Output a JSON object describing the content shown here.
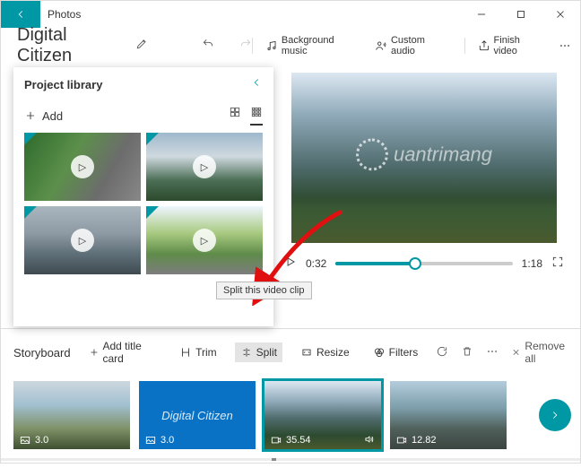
{
  "window": {
    "title": "Photos"
  },
  "project": {
    "name": "Digital Citizen"
  },
  "toolbar": {
    "bg_music": "Background music",
    "custom_audio": "Custom audio",
    "finish": "Finish video"
  },
  "library": {
    "title": "Project library",
    "add": "Add"
  },
  "player": {
    "current": "0:32",
    "duration": "1:18"
  },
  "tooltip": {
    "split": "Split this video clip"
  },
  "storyboard": {
    "title": "Storyboard",
    "add_title_card": "Add title card",
    "trim": "Trim",
    "split": "Split",
    "resize": "Resize",
    "filters": "Filters",
    "remove_all": "Remove all",
    "clips": [
      {
        "duration": "3.0",
        "label": ""
      },
      {
        "duration": "3.0",
        "label": "Digital Citizen"
      },
      {
        "duration": "35.54",
        "label": ""
      },
      {
        "duration": "12.82",
        "label": ""
      }
    ]
  },
  "watermark": {
    "text": "uantrimang"
  }
}
